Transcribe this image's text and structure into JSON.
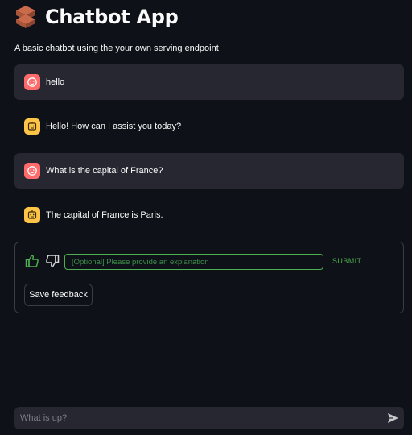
{
  "header": {
    "title": "Chatbot App",
    "subtitle": "A basic chatbot using the your own serving endpoint",
    "logo_icon": "brick-icon"
  },
  "messages": [
    {
      "role": "user",
      "text": "hello",
      "avatar_icon": "user-face-icon"
    },
    {
      "role": "assistant",
      "text": "Hello! How can I assist you today?",
      "avatar_icon": "robot-icon"
    },
    {
      "role": "user",
      "text": "What is the capital of France?",
      "avatar_icon": "user-face-icon"
    },
    {
      "role": "assistant",
      "text": "The capital of France is Paris.",
      "avatar_icon": "robot-icon"
    }
  ],
  "feedback": {
    "thumbs_up_icon": "thumbs-up-icon",
    "thumbs_down_icon": "thumbs-down-icon",
    "explanation_placeholder": "[Optional] Please provide an explanation",
    "explanation_value": "",
    "submit_label": "SUBMIT",
    "save_label": "Save feedback"
  },
  "chat_input": {
    "placeholder": "What is up?",
    "value": "",
    "send_icon": "send-icon"
  },
  "colors": {
    "background": "#0e1117",
    "surface": "#262730",
    "user_avatar": "#ff6b6b",
    "bot_avatar": "#fdc448",
    "accent_green": "#4caf50"
  }
}
